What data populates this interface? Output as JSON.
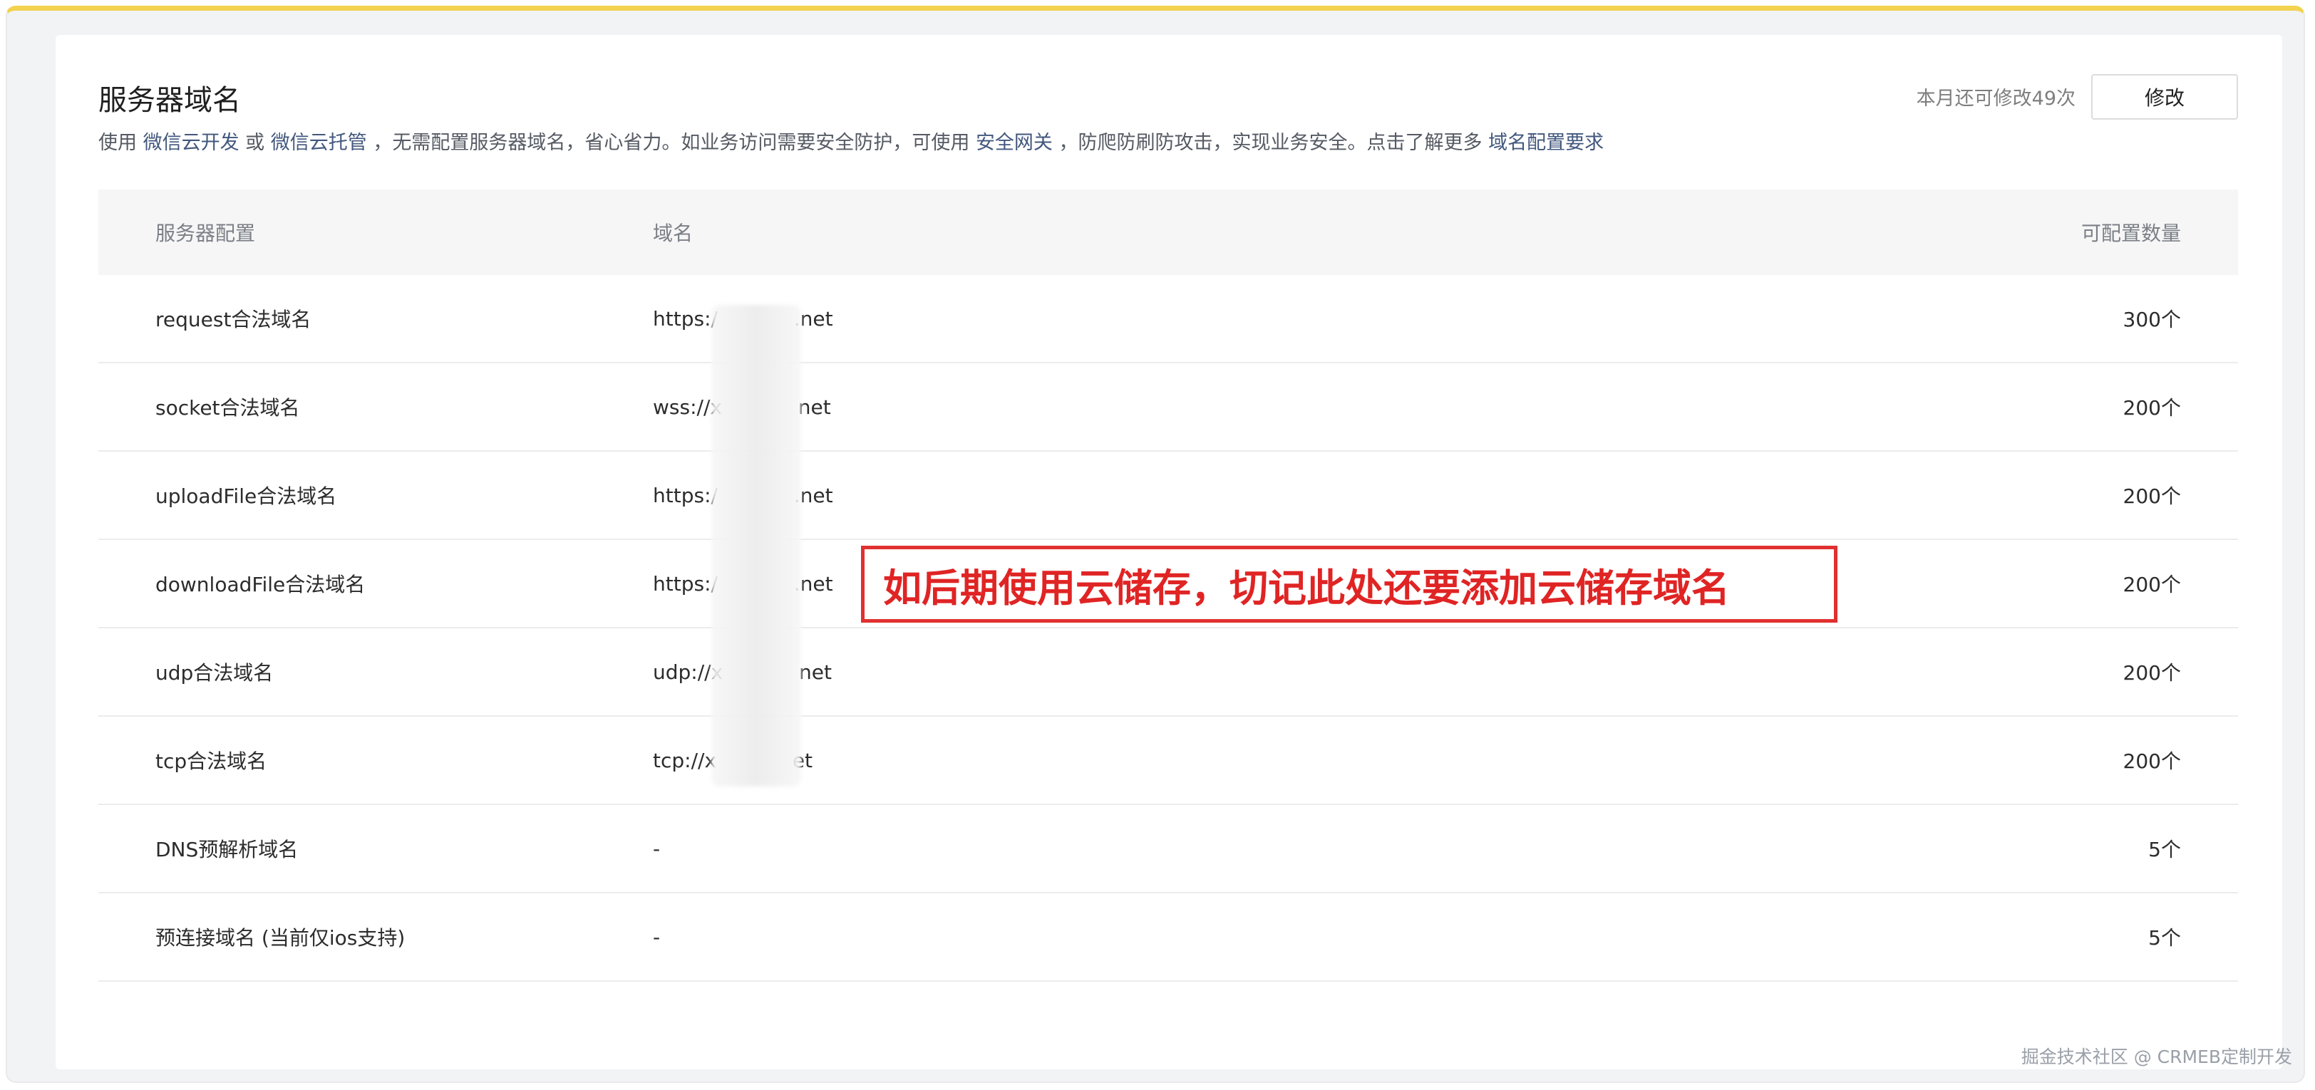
{
  "header": {
    "title": "服务器域名",
    "desc_use": "使用 ",
    "link_cloud_dev": "微信云开发",
    "desc_or": " 或 ",
    "link_cloud_hosting": "微信云托管",
    "desc_mid": " ，无需配置服务器域名，省心省力。如业务访问需要安全防护，可使用 ",
    "link_security_gateway": "安全网关",
    "desc_end": " ，防爬防刷防攻击，实现业务安全。点击了解更多 ",
    "link_domain_requirements": "域名配置要求",
    "remaining_text": "本月还可修改49次",
    "edit_button": "修改"
  },
  "table": {
    "columns": [
      "服务器配置",
      "域名",
      "可配置数量"
    ],
    "rows": [
      {
        "config": "request合法域名",
        "domain": "https:/            .net",
        "count": "300个"
      },
      {
        "config": "socket合法域名",
        "domain": "wss://x            net",
        "count": "200个"
      },
      {
        "config": "uploadFile合法域名",
        "domain": "https:/            .net",
        "count": "200个"
      },
      {
        "config": "downloadFile合法域名",
        "domain": "https:/            .net",
        "count": "200个"
      },
      {
        "config": "udp合法域名",
        "domain": "udp://x            net",
        "count": "200个"
      },
      {
        "config": "tcp合法域名",
        "domain": "tcp://x            et",
        "count": "200个"
      },
      {
        "config": "DNS预解析域名",
        "domain": "-",
        "count": "5个"
      },
      {
        "config": "预连接域名 (当前仅ios支持)",
        "domain": "-",
        "count": "5个"
      }
    ]
  },
  "annotation": {
    "text": "如后期使用云储存，切记此处还要添加云储存域名",
    "color": "#e02424"
  },
  "watermark": "掘金技术社区 @ CRMEB定制开发",
  "colors": {
    "link": "#42577d",
    "top_accent": "#f2d24e",
    "annotation_border": "#e03030"
  }
}
